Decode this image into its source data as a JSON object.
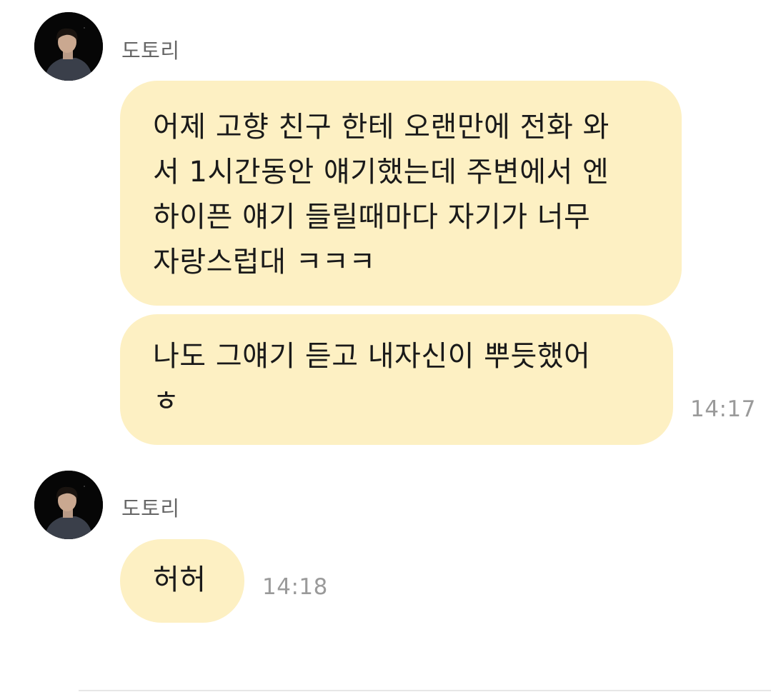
{
  "groups": [
    {
      "sender": "도토리",
      "messages": [
        {
          "text": "어제 고향 친구 한테 오랜만에 전화 와\n서 1시간동안 얘기했는데 주변에서 엔\n하이픈 얘기 들릴때마다 자기가 너무\n자랑스럽대 ㅋㅋㅋ",
          "time": ""
        },
        {
          "text": "나도 그얘기 듣고 내자신이 뿌듯했어\nㅎ",
          "time": "14:17"
        }
      ]
    },
    {
      "sender": "도토리",
      "messages": [
        {
          "text": "허허",
          "time": "14:18"
        }
      ]
    }
  ],
  "colors": {
    "bubble": "#fdf0c3",
    "name": "#666666",
    "timestamp": "#9a9a9a"
  },
  "icons": {
    "avatar": "profile-photo-avatar"
  }
}
